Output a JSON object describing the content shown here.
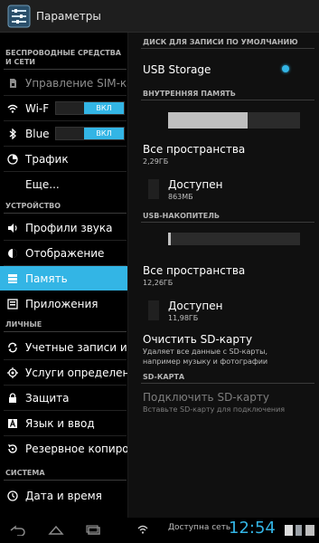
{
  "actionbar": {
    "title": "Параметры"
  },
  "left": {
    "cat_wireless": "БЕСПРОВОДНЫЕ СРЕДСТВА И СЕТИ",
    "item_sim": "Управление SIM-ка",
    "item_wifi": "Wi-F",
    "wifi_toggle": "ВКЛ",
    "item_bt": "Blue",
    "bt_toggle": "ВКЛ",
    "item_traffic": "Трафик",
    "item_more": "Еще...",
    "cat_device": "УСТРОЙСТВО",
    "item_sound": "Профили звука",
    "item_display": "Отображение",
    "item_memory": "Память",
    "item_apps": "Приложения",
    "cat_personal": "ЛИЧНЫЕ",
    "item_accounts": "Учетные записи и с",
    "item_location": "Услуги определени",
    "item_security": "Защита",
    "item_lang": "Язык и ввод",
    "item_backup": "Резервное копиров",
    "cat_system": "СИСТЕМА",
    "item_datetime": "Дата и время"
  },
  "right": {
    "cat_default_write": "ДИСК ДЛЯ ЗАПИСИ ПО УМОЛЧАНИЮ",
    "usb_storage": "USB Storage",
    "cat_internal": "ВНУТРЕННЯЯ ПАМЯТЬ",
    "internal_used_fraction": 0.6,
    "internal_total_title": "Все пространства",
    "internal_total_value": "2,29ГБ",
    "internal_avail_title": "Доступен",
    "internal_avail_value": "863МБ",
    "cat_usb": "USB-НАКОПИТЕЛЬ",
    "usb_used_fraction": 0.02,
    "usb_total_title": "Все пространства",
    "usb_total_value": "12,26ГБ",
    "usb_avail_title": "Доступен",
    "usb_avail_value": "11,98ГБ",
    "clear_sd_title": "Очистить SD-карту",
    "clear_sd_sub1": "Удаляет все данные с SD-карты,",
    "clear_sd_sub2": "например музыку и фотографии",
    "cat_sd": "SD-КАРТА",
    "mount_sd_title": "Подключить SD-карту",
    "mount_sd_sub": "Вставьте SD-карту для подключения"
  },
  "navbar": {
    "status_text": "Доступна сеть",
    "clock": "12:54"
  },
  "colors": {
    "accent": "#33b5e5"
  }
}
